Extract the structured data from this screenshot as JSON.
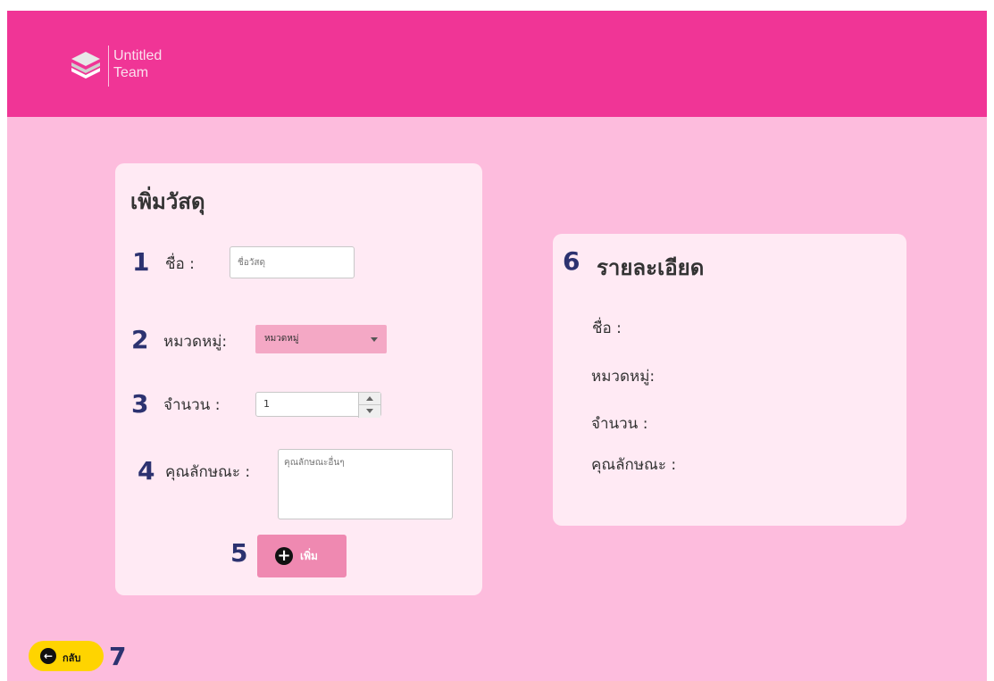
{
  "brand": {
    "line1": "Untitled",
    "line2": "Team"
  },
  "form": {
    "title": "เพิ่มวัสดุ",
    "name": {
      "num": "1",
      "label": "ชื่อ :",
      "placeholder": "ชื่อวัสดุ"
    },
    "category": {
      "num": "2",
      "label": "หมวดหมู่:",
      "selected": "หมวดหมู่"
    },
    "quantity": {
      "num": "3",
      "label": "จำนวน :",
      "value": "1"
    },
    "property": {
      "num": "4",
      "label": "คุณลักษณะ :",
      "placeholder": "คุณลักษณะอื่นๆ"
    },
    "add": {
      "num": "5",
      "label": "เพิ่ม"
    }
  },
  "detail": {
    "num": "6",
    "title": "รายละเอียด",
    "name_label": "ชื่อ :",
    "category_label": "หมวดหมู่:",
    "quantity_label": "จำนวน :",
    "property_label": "คุณลักษณะ :"
  },
  "back": {
    "label": "กลับ",
    "num": "7"
  },
  "colors": {
    "header": "#f03596",
    "page": "#fdbcdd",
    "card": "#ffeaf4",
    "accent_button": "#ef89b1",
    "back_button": "#ffd400"
  }
}
